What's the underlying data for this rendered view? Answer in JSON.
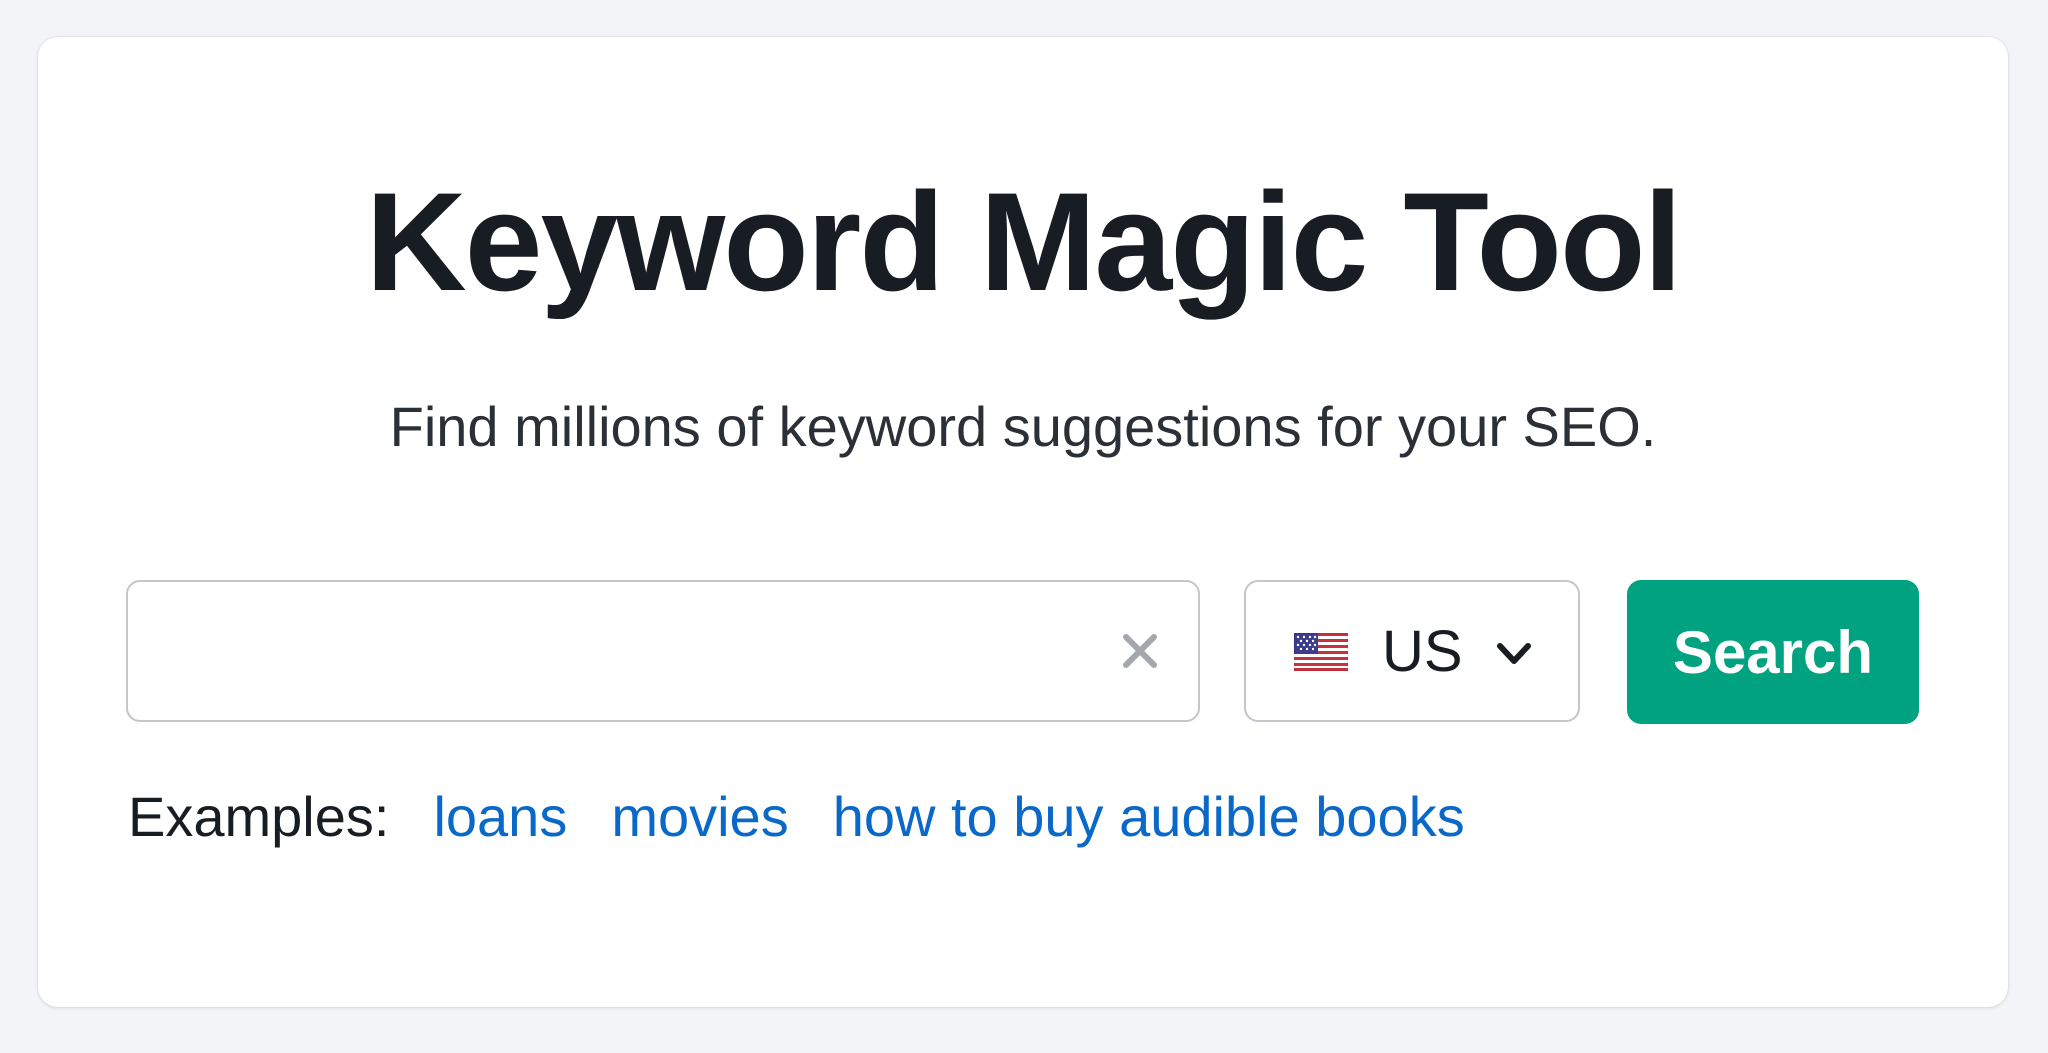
{
  "header": {
    "title": "Keyword Magic Tool",
    "subtitle": "Find millions of keyword suggestions for your SEO."
  },
  "search": {
    "value": "",
    "placeholder": "",
    "clear_icon": "close-icon"
  },
  "country": {
    "code": "US",
    "flag_icon": "us-flag-icon",
    "chevron_icon": "chevron-down-icon"
  },
  "search_button": {
    "label": "Search",
    "color": "#00a27f"
  },
  "examples": {
    "label": "Examples:",
    "items": [
      "loans",
      "movies",
      "how to buy audible books"
    ],
    "link_color": "#0a69c8"
  }
}
